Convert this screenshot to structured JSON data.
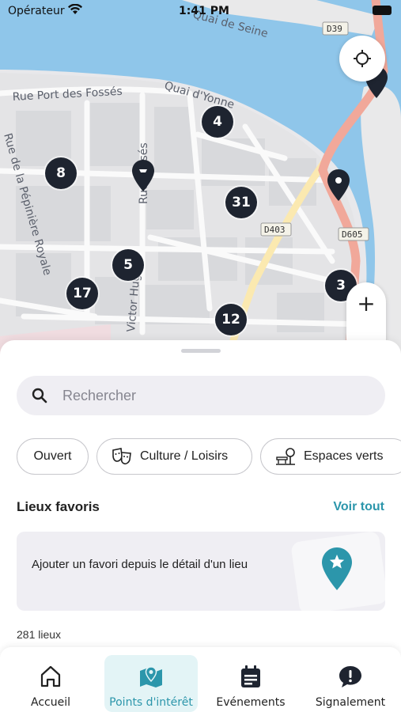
{
  "status_bar": {
    "carrier": "Opérateur",
    "time": "1:41 PM"
  },
  "map": {
    "streets": {
      "quai_seine": "Quai de Seine",
      "rue_port_des_fosses": "Rue Port des Fossés",
      "quai_yonne": "Quai d'Yonne",
      "rue_fosses": "Rue Fossés",
      "rue_pepiniere": "Rue de la Pépinière Royale",
      "victor_hugo": "Victor Hugo"
    },
    "road_badges": {
      "d39": "D39",
      "d403": "D403",
      "d605": "D605"
    },
    "clusters": [
      {
        "label": "4"
      },
      {
        "label": "8"
      },
      {
        "label": "31"
      },
      {
        "label": "5"
      },
      {
        "label": "17"
      },
      {
        "label": "3"
      },
      {
        "label": "12"
      }
    ],
    "zoom_in_symbol": "+"
  },
  "search": {
    "placeholder": "Rechercher",
    "value": ""
  },
  "filters": [
    {
      "label": "Ouvert"
    },
    {
      "label": "Culture / Loisirs"
    },
    {
      "label": "Espaces verts"
    }
  ],
  "favorites": {
    "title": "Lieux favoris",
    "see_all": "Voir tout",
    "empty_text": "Ajouter un favori depuis le détail d'un lieu"
  },
  "places_count": "281 lieux",
  "tabs": [
    {
      "label": "Accueil",
      "icon": "home-icon",
      "active": false
    },
    {
      "label": "Points d'intérêt",
      "icon": "map-pin-icon",
      "active": true
    },
    {
      "label": "Evénements",
      "icon": "calendar-icon",
      "active": false
    },
    {
      "label": "Signalement",
      "icon": "alert-bubble-icon",
      "active": false
    }
  ],
  "colors": {
    "accent": "#2c96ab",
    "cluster": "#1e2430",
    "water": "#8fc6ea",
    "main_road": "#f1a89a"
  }
}
